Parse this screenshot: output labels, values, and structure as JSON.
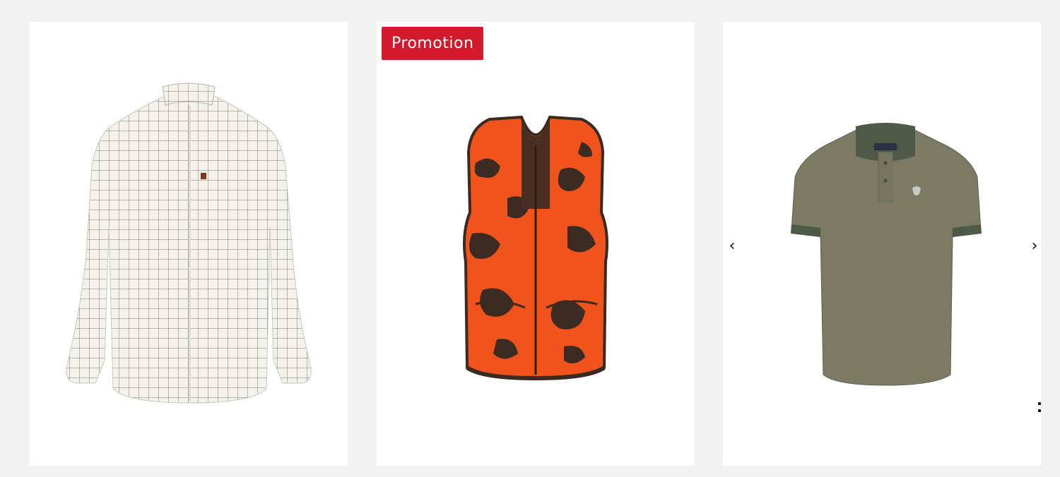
{
  "products": [
    {
      "image": "checked-shirt",
      "badge": null
    },
    {
      "image": "orange-camo-vest",
      "badge": "Promotion"
    },
    {
      "image": "olive-polo-shirt",
      "badge": null
    }
  ],
  "colors": {
    "badge": "#d31a2c",
    "background": "#f2f2f2",
    "card": "#ffffff"
  },
  "carousel": {
    "prev_icon": "chevron-left-icon",
    "next_icon": "chevron-right-icon",
    "prev_label": "‹",
    "next_label": "›"
  }
}
